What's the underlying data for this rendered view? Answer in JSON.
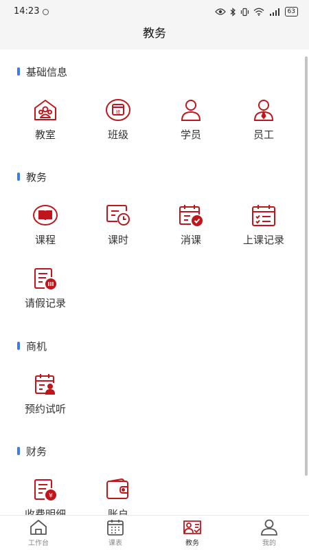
{
  "status_bar": {
    "time": "14:23",
    "battery": "63"
  },
  "header": {
    "title": "教务"
  },
  "colors": {
    "icon": "#c0161b",
    "accent_bar": "#3a7bf0",
    "tab_inactive": "#555555",
    "tab_active": "#c0161b"
  },
  "sections": [
    {
      "title": "基础信息",
      "items": [
        {
          "label": "教室",
          "icon": "classroom-icon"
        },
        {
          "label": "班级",
          "icon": "class-icon"
        },
        {
          "label": "学员",
          "icon": "student-icon"
        },
        {
          "label": "员工",
          "icon": "staff-icon"
        }
      ]
    },
    {
      "title": "教务",
      "items": [
        {
          "label": "课程",
          "icon": "course-book-icon"
        },
        {
          "label": "课时",
          "icon": "class-hours-icon"
        },
        {
          "label": "消课",
          "icon": "consume-class-icon"
        },
        {
          "label": "上课记录",
          "icon": "attendance-record-icon"
        },
        {
          "label": "请假记录",
          "icon": "leave-record-icon"
        }
      ]
    },
    {
      "title": "商机",
      "items": [
        {
          "label": "预约试听",
          "icon": "trial-booking-icon"
        }
      ]
    },
    {
      "title": "财务",
      "items": [
        {
          "label": "收费明细",
          "icon": "fee-detail-icon"
        },
        {
          "label": "账户",
          "icon": "wallet-icon"
        }
      ]
    }
  ],
  "tabbar": [
    {
      "label": "工作台",
      "icon": "home-icon"
    },
    {
      "label": "课表",
      "icon": "calendar-icon"
    },
    {
      "label": "教务",
      "icon": "academic-icon",
      "active": true
    },
    {
      "label": "我的",
      "icon": "profile-icon"
    }
  ]
}
